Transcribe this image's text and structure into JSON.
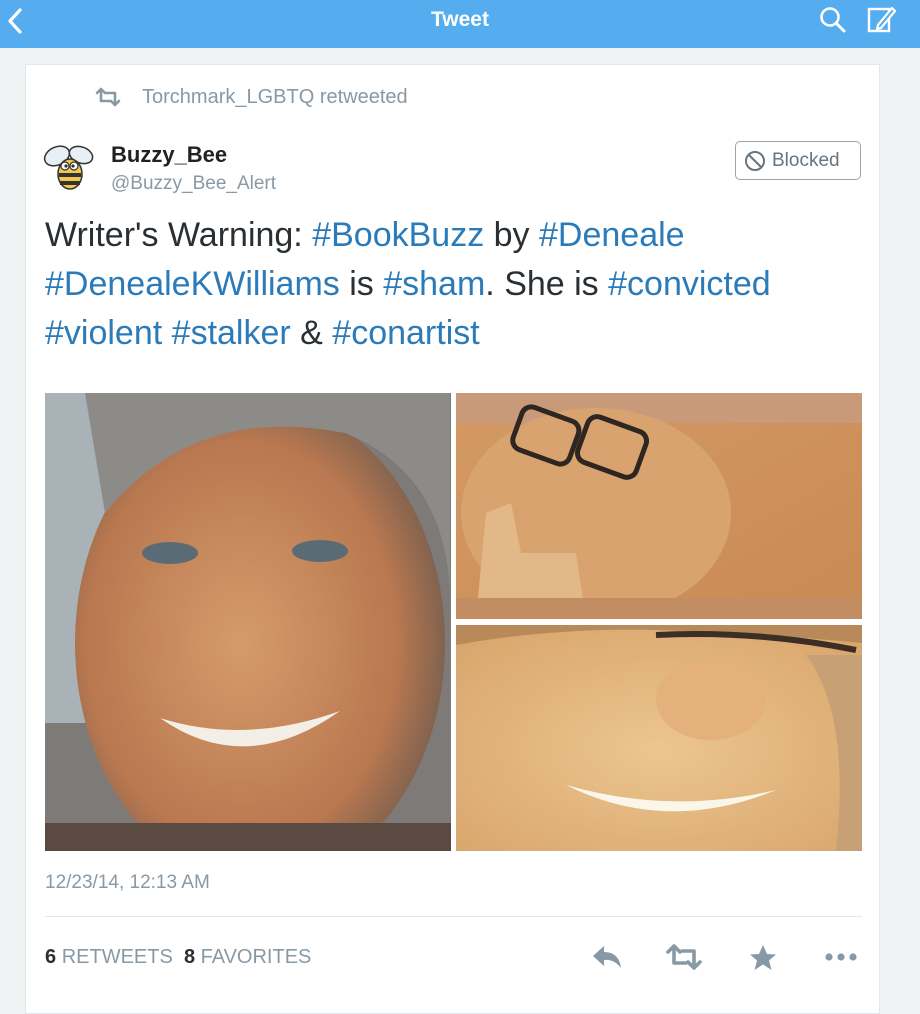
{
  "nav": {
    "title": "Tweet",
    "back_icon": "chevron-left-icon",
    "search_icon": "search-icon",
    "compose_icon": "compose-icon",
    "bar_color": "#55acee"
  },
  "retweet_context": {
    "icon": "retweet-icon",
    "text": "Torchmark_LGBTQ retweeted"
  },
  "author": {
    "avatar_icon": "bee-avatar-icon",
    "display_name": "Buzzy_Bee",
    "handle": "@Buzzy_Bee_Alert",
    "blocked_label": "Blocked",
    "blocked_icon": "block-icon"
  },
  "tweet": {
    "segments": [
      {
        "text": "Writer's Warning: "
      },
      {
        "text": "#BookBuzz",
        "hashtag": true
      },
      {
        "text": " by "
      },
      {
        "text": "#Deneale",
        "hashtag": true
      },
      {
        "text": " "
      },
      {
        "text": "#DenealeKWilliams",
        "hashtag": true
      },
      {
        "text": " is "
      },
      {
        "text": "#sham",
        "hashtag": true
      },
      {
        "text": ". She is "
      },
      {
        "text": "#convicted",
        "hashtag": true
      },
      {
        "text": " "
      },
      {
        "text": "#violent",
        "hashtag": true
      },
      {
        "text": " "
      },
      {
        "text": "#stalker",
        "hashtag": true
      },
      {
        "text": " & "
      },
      {
        "text": "#conartist",
        "hashtag": true
      }
    ],
    "hashtag_color": "#2b7bb9",
    "timestamp": "12/23/14, 12:13 AM"
  },
  "stats": {
    "retweets_count": "6",
    "retweets_label": "RETWEETS",
    "favorites_count": "8",
    "favorites_label": "FAVORITES"
  },
  "actions": {
    "reply_icon": "reply-icon",
    "retweet_icon": "retweet-icon",
    "favorite_icon": "star-icon",
    "more_icon": "more-icon"
  }
}
